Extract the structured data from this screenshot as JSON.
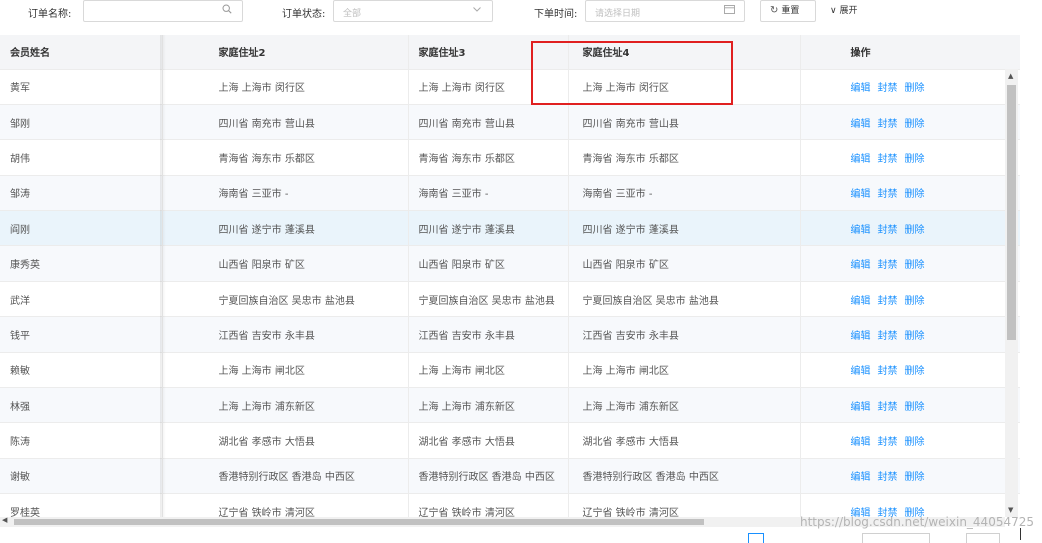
{
  "filters": {
    "order_name_label": "订单名称:",
    "order_name_value": "",
    "order_status_label": "订单状态:",
    "order_status_placeholder": "全部",
    "order_time_label": "下单时间:",
    "order_time_placeholder": "请选择日期",
    "reset_label": "重置",
    "expand_label": "展开"
  },
  "icons": {
    "search": "search-icon",
    "chevron": "chevron-down-icon",
    "calendar": "calendar-icon",
    "reset": "reset-icon",
    "expand": "chevron-down-icon"
  },
  "table": {
    "columns": [
      "会员姓名",
      "家庭住址2",
      "家庭住址3",
      "家庭住址4",
      "操作"
    ],
    "actions": [
      "编辑",
      "封禁",
      "删除"
    ],
    "highlighted_row": 4,
    "rows": [
      [
        "黄军",
        "上海 上海市 闵行区",
        "上海 上海市 闵行区",
        "上海 上海市 闵行区"
      ],
      [
        "邹刚",
        "四川省 南充市 营山县",
        "四川省 南充市 营山县",
        "四川省 南充市 营山县"
      ],
      [
        "胡伟",
        "青海省 海东市 乐都区",
        "青海省 海东市 乐都区",
        "青海省 海东市 乐都区"
      ],
      [
        "邹涛",
        "海南省 三亚市 -",
        "海南省 三亚市 -",
        "海南省 三亚市 -"
      ],
      [
        "阎刚",
        "四川省 遂宁市 蓬溪县",
        "四川省 遂宁市 蓬溪县",
        "四川省 遂宁市 蓬溪县"
      ],
      [
        "康秀英",
        "山西省 阳泉市 矿区",
        "山西省 阳泉市 矿区",
        "山西省 阳泉市 矿区"
      ],
      [
        "武洋",
        "宁夏回族自治区 吴忠市 盐池县",
        "宁夏回族自治区 吴忠市 盐池县",
        "宁夏回族自治区 吴忠市 盐池县"
      ],
      [
        "钱平",
        "江西省 吉安市 永丰县",
        "江西省 吉安市 永丰县",
        "江西省 吉安市 永丰县"
      ],
      [
        "赖敏",
        "上海 上海市 闸北区",
        "上海 上海市 闸北区",
        "上海 上海市 闸北区"
      ],
      [
        "林强",
        "上海 上海市 浦东新区",
        "上海 上海市 浦东新区",
        "上海 上海市 浦东新区"
      ],
      [
        "陈涛",
        "湖北省 孝感市 大悟县",
        "湖北省 孝感市 大悟县",
        "湖北省 孝感市 大悟县"
      ],
      [
        "谢敏",
        "香港特别行政区 香港岛 中西区",
        "香港特别行政区 香港岛 中西区",
        "香港特别行政区 香港岛 中西区"
      ],
      [
        "罗桂英",
        "辽宁省 铁岭市 清河区",
        "辽宁省 铁岭市 清河区",
        "辽宁省 铁岭市 清河区"
      ]
    ]
  },
  "watermark": "https://blog.csdn.net/weixin_44054725",
  "colors": {
    "action_link": "#1890ff",
    "annotation_box": "#e02020",
    "header_bg": "#f4f5f7",
    "highlight_row_bg": "#eaf4fb"
  }
}
